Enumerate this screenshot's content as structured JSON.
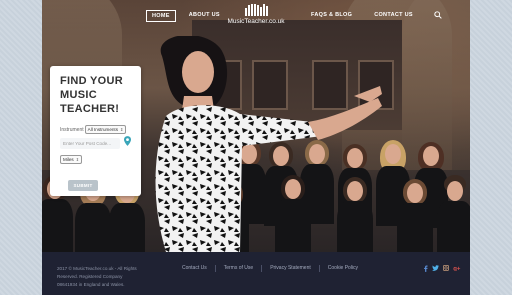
{
  "nav": {
    "left": [
      {
        "label": "HOME",
        "active": true
      },
      {
        "label": "ABOUT US",
        "active": false
      }
    ],
    "right": [
      {
        "label": "FAQS & BLOG"
      },
      {
        "label": "CONTACT US"
      }
    ],
    "search_icon": "search-icon"
  },
  "logo": {
    "text": "MusicTeacher.co.uk"
  },
  "card": {
    "title_line1": "FIND YOUR",
    "title_line2": "MUSIC",
    "title_line3": "TEACHER!",
    "instrument_label": "Instrument",
    "instrument_value": "All Instruments",
    "postcode_placeholder": "Enter Your Post Code...",
    "distance_value": "Miles",
    "submit_label": "SUBMIT",
    "pin_icon": "map-pin-icon"
  },
  "footer": {
    "copy_line1": "2017 © MusicTeacher.co.uk - All Rights",
    "copy_line2": "Reserved. Registered Company",
    "copy_line3": "08641934 in England and Wales.",
    "links": [
      "Contact Us",
      "Terms of Use",
      "Privacy Statement",
      "Cookie Policy"
    ],
    "social": [
      {
        "icon": "facebook-icon",
        "glyph": "f",
        "color": "#5b8ed6"
      },
      {
        "icon": "twitter-icon",
        "glyph": "t",
        "color": "#4fb0e8"
      },
      {
        "icon": "instagram-icon",
        "glyph": "◙",
        "color": "#c49a7a"
      },
      {
        "icon": "google-plus-icon",
        "glyph": "g+",
        "color": "#d9534f"
      }
    ]
  },
  "colors": {
    "footer_bg": "#1f2233",
    "page_side": "#c9d3dc",
    "pin": "#3aa6b9"
  }
}
